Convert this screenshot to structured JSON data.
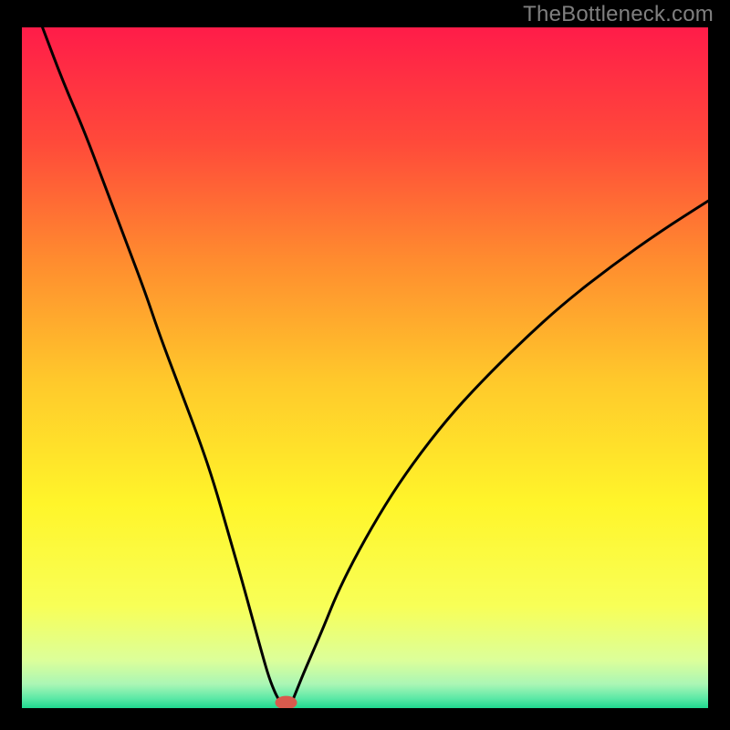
{
  "watermark": "TheBottleneck.com",
  "chart_data": {
    "type": "line",
    "title": "",
    "xlabel": "",
    "ylabel": "",
    "xlim": [
      0,
      100
    ],
    "ylim": [
      0,
      100
    ],
    "grid": false,
    "legend": false,
    "background_gradient_stops": [
      {
        "offset": 0,
        "color": "#ff1c49"
      },
      {
        "offset": 0.17,
        "color": "#ff4a3a"
      },
      {
        "offset": 0.34,
        "color": "#ff8b2f"
      },
      {
        "offset": 0.52,
        "color": "#ffc92b"
      },
      {
        "offset": 0.7,
        "color": "#fff52a"
      },
      {
        "offset": 0.85,
        "color": "#f8ff57"
      },
      {
        "offset": 0.93,
        "color": "#dcff9a"
      },
      {
        "offset": 0.965,
        "color": "#aaf6b5"
      },
      {
        "offset": 0.985,
        "color": "#5fe9a7"
      },
      {
        "offset": 1.0,
        "color": "#1fd88f"
      }
    ],
    "series": [
      {
        "name": "left-curve",
        "x": [
          3,
          6,
          9,
          12,
          15,
          18,
          20,
          23,
          26,
          28,
          30,
          32,
          33.5,
          35,
          36,
          37,
          37.6
        ],
        "values": [
          100,
          92,
          85,
          77,
          69,
          61,
          55,
          47,
          39,
          33,
          26,
          19,
          13.5,
          8,
          4.5,
          2,
          1
        ]
      },
      {
        "name": "right-curve",
        "x": [
          39.4,
          40,
          41,
          42.5,
          44,
          46,
          49,
          53,
          57,
          62,
          67,
          73,
          79,
          86,
          93,
          100
        ],
        "values": [
          1,
          2.5,
          5,
          8.5,
          12,
          17,
          23,
          30,
          36,
          42.5,
          48,
          54,
          59.5,
          65,
          70,
          74.5
        ]
      }
    ],
    "marker": {
      "x": 38.5,
      "y": 0.8,
      "color": "#d85a4d",
      "rx": 1.6,
      "ry": 1.0
    }
  }
}
